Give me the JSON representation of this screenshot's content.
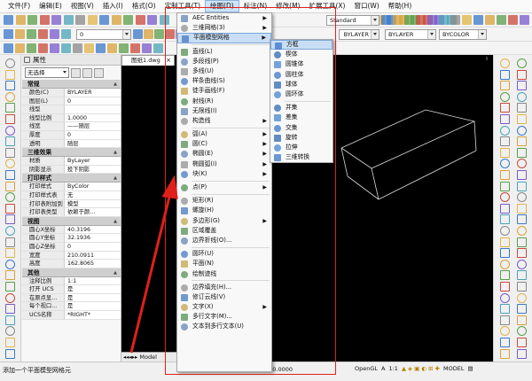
{
  "menubar": {
    "items": [
      "文件(F)",
      "编辑(E)",
      "视图(V)",
      "插入(I)",
      "格式(O)",
      "定制工具(T)",
      "绘图(D)",
      "标注(N)",
      "修改(M)",
      "扩展工具(X)",
      "窗口(W)",
      "帮助(H)"
    ],
    "active_index": 6
  },
  "toolbar": {
    "layer_value": "0",
    "textstyle_value": "Standard",
    "linetype_value": "BYLAYER",
    "lineweight_value": "BYLAYER",
    "color_value": "BYCOLOR"
  },
  "properties": {
    "title": "属性",
    "selection": "无选择",
    "groups": [
      {
        "name": "常规",
        "rows": [
          {
            "k": "颜色(C)",
            "v": "BYLAYER"
          },
          {
            "k": "图层(L)",
            "v": "0"
          },
          {
            "k": "线型",
            "v": ""
          },
          {
            "k": "线型比例",
            "v": "1.0000"
          },
          {
            "k": "线宽",
            "v": "——随层"
          },
          {
            "k": "厚度",
            "v": "0"
          },
          {
            "k": "透明",
            "v": "随层"
          }
        ]
      },
      {
        "name": "三维效果",
        "rows": [
          {
            "k": "材质",
            "v": "ByLayer"
          },
          {
            "k": "阴影显示",
            "v": "投下阴影"
          }
        ]
      },
      {
        "name": "打印样式",
        "rows": [
          {
            "k": "打印样式",
            "v": "ByColor"
          },
          {
            "k": "打印样式表",
            "v": "无"
          },
          {
            "k": "打印表附加到",
            "v": "模型"
          },
          {
            "k": "打印表类型",
            "v": "依赖于颜..."
          }
        ]
      },
      {
        "name": "视图",
        "rows": [
          {
            "k": "圆心X坐标",
            "v": "40.3196"
          },
          {
            "k": "圆心Y坐标",
            "v": "32.1936"
          },
          {
            "k": "圆心Z坐标",
            "v": "0"
          },
          {
            "k": "宽度",
            "v": "210.0911"
          },
          {
            "k": "高度",
            "v": "162.8065"
          }
        ]
      },
      {
        "name": "其他",
        "rows": [
          {
            "k": "注释比例",
            "v": "1:1"
          },
          {
            "k": "打开 UCS",
            "v": "是"
          },
          {
            "k": "在原点显...",
            "v": "是"
          },
          {
            "k": "每个视口...",
            "v": "是"
          },
          {
            "k": "UCS名称",
            "v": "*RIGHT*"
          }
        ]
      }
    ]
  },
  "drawing": {
    "tab_label": "图纸1.dwg",
    "layout_tab": "Model"
  },
  "draw_menu": {
    "items": [
      {
        "label": "AEC Entities",
        "sub": true
      },
      {
        "label": "三维网格(3)",
        "sub": true
      },
      {
        "label": "平面模型网格",
        "sub": true,
        "hl": true
      },
      {
        "sep": true
      },
      {
        "label": "直线(L)"
      },
      {
        "label": "多段线(P)"
      },
      {
        "label": "多线(U)"
      },
      {
        "label": "样条曲线(S)"
      },
      {
        "label": "徒手画线(F)"
      },
      {
        "label": "射线(R)"
      },
      {
        "label": "无限线(I)"
      },
      {
        "label": "构造线",
        "sub": true
      },
      {
        "sep": true
      },
      {
        "label": "弧(A)",
        "sub": true
      },
      {
        "label": "圆(C)",
        "sub": true
      },
      {
        "label": "椭圆(E)",
        "sub": true
      },
      {
        "label": "椭圆弧(I)",
        "sub": true
      },
      {
        "label": "块(K)",
        "sub": true
      },
      {
        "sep": true
      },
      {
        "label": "点(P)",
        "sub": true
      },
      {
        "sep": true
      },
      {
        "label": "矩形(R)"
      },
      {
        "label": "螺旋(H)"
      },
      {
        "label": "多边形(G)",
        "sub": true
      },
      {
        "label": "区域覆盖"
      },
      {
        "label": "边界折线(O)..."
      },
      {
        "sep": true
      },
      {
        "label": "圆环(U)"
      },
      {
        "label": "平面(N)"
      },
      {
        "label": "绘制迹线"
      },
      {
        "sep": true
      },
      {
        "label": "边界填充(H)..."
      },
      {
        "label": "修订云线(V)"
      },
      {
        "label": "文字(X)",
        "sub": true
      },
      {
        "label": "多行文字(M)..."
      },
      {
        "label": "文本到多行文本(U)"
      }
    ]
  },
  "submenu": {
    "items": [
      {
        "label": "方框",
        "hl": true
      },
      {
        "label": "楔体"
      },
      {
        "label": "圆锥体"
      },
      {
        "label": "圆柱体"
      },
      {
        "label": "球体"
      },
      {
        "label": "圆环体"
      },
      {
        "sep": true
      },
      {
        "label": "并集"
      },
      {
        "label": "差集"
      },
      {
        "label": "交集"
      },
      {
        "label": "旋转"
      },
      {
        "label": "拉伸"
      },
      {
        "label": "三维转换"
      }
    ]
  },
  "status": {
    "message": "添加一个平面模型网格元",
    "coords": "7,155.4509,0.0000",
    "opengl": "OpenGL",
    "scale": "1:1",
    "model": "MODEL"
  },
  "colors": {
    "accent_highlight": "#c9def5",
    "annotation_red": "#e0201a",
    "canvas": "#000000"
  }
}
